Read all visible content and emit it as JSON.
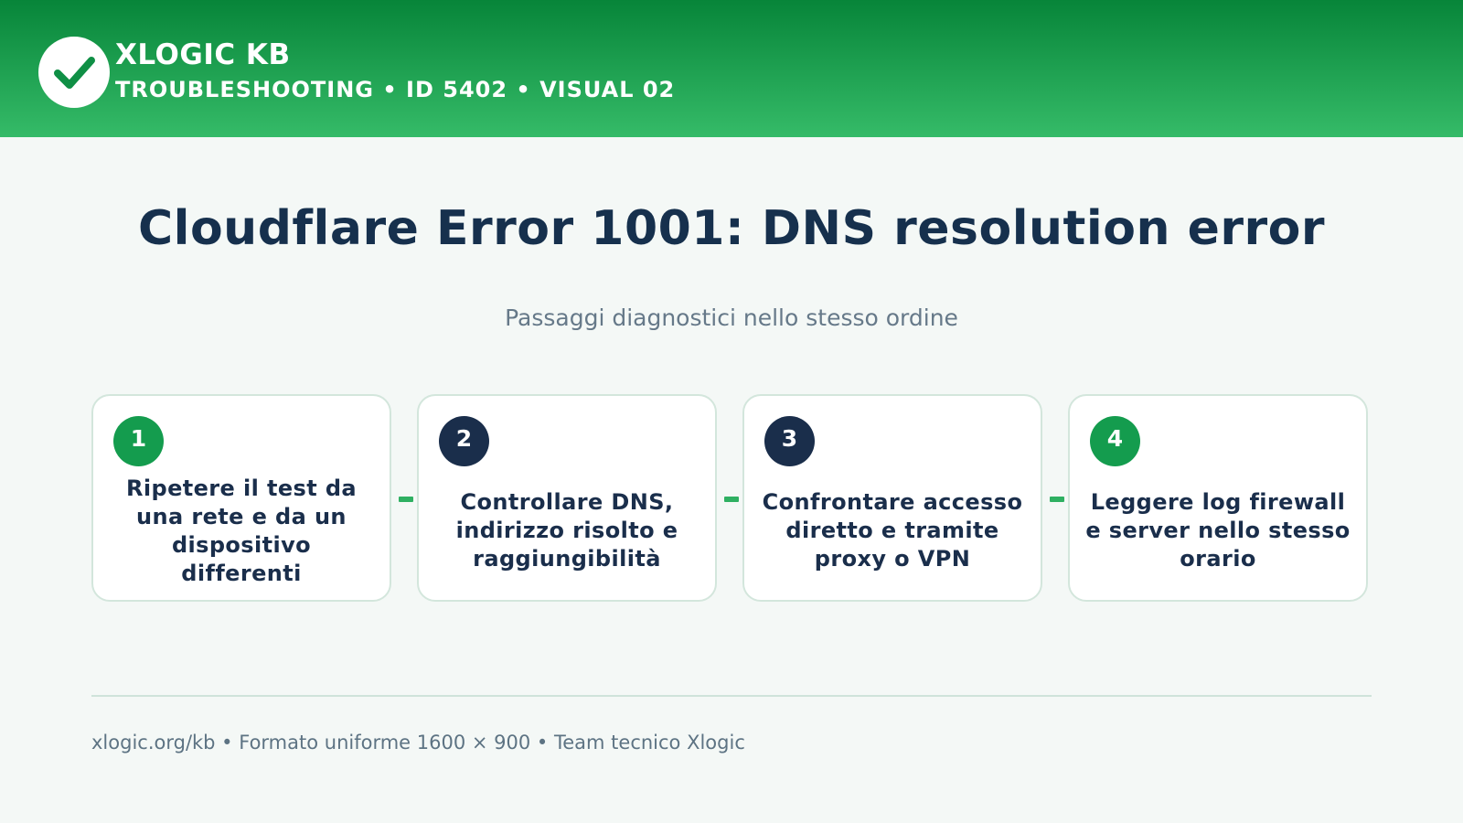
{
  "header": {
    "brand": "XLOGIC KB",
    "meta": "TROUBLESHOOTING • ID 5402 • VISUAL 02",
    "logo_icon": "check-icon",
    "colors": {
      "gradient_top": "#078539",
      "gradient_bottom": "#35bb68"
    }
  },
  "main": {
    "title": "Cloudflare Error 1001: DNS resolution error",
    "subtitle": "Passaggi diagnostici nello stesso ordine"
  },
  "steps": [
    {
      "number": "1",
      "badge_color": "#149c4e",
      "text": "Ripetere il test da una rete e da un dispositivo differenti"
    },
    {
      "number": "2",
      "badge_color": "#1a2e4b",
      "text": "Controllare DNS, indirizzo risolto e raggiungibilità"
    },
    {
      "number": "3",
      "badge_color": "#1a2e4b",
      "text": "Confrontare accesso diretto e tramite proxy o VPN"
    },
    {
      "number": "4",
      "badge_color": "#149c4e",
      "text": "Leggere log firewall e server nello stesso orario"
    }
  ],
  "footer": {
    "text": "xlogic.org/kb • Formato uniforme 1600 × 900 • Team tecnico Xlogic"
  }
}
